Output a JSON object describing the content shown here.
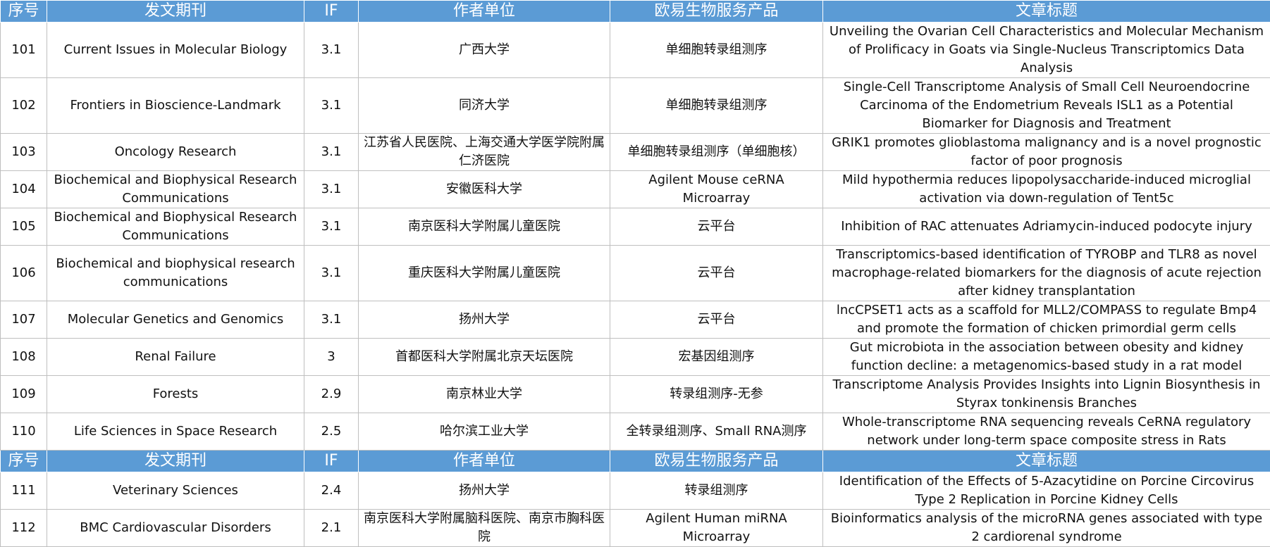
{
  "headers": [
    "序号",
    "发文期刊",
    "IF",
    "作者单位",
    "欧易生物服务产品",
    "文章标题"
  ],
  "rows_a": [
    {
      "no": "101",
      "journal": "Current Issues in Molecular Biology",
      "if": "3.1",
      "unit": "广西大学",
      "service": "单细胞转录组测序",
      "title": "Unveiling the Ovarian Cell Characteristics and Molecular Mechanism of Prolificacy in Goats via Single-Nucleus Transcriptomics Data Analysis"
    },
    {
      "no": "102",
      "journal": "Frontiers in Bioscience-Landmark",
      "if": "3.1",
      "unit": "同济大学",
      "service": "单细胞转录组测序",
      "title": "Single-Cell Transcriptome Analysis of Small Cell Neuroendocrine Carcinoma of the Endometrium Reveals ISL1 as a Potential Biomarker for Diagnosis and Treatment"
    },
    {
      "no": "103",
      "journal": "Oncology Research",
      "if": "3.1",
      "unit": "江苏省人民医院、上海交通大学医学院附属仁济医院",
      "service": "单细胞转录组测序（单细胞核）",
      "title": "GRIK1 promotes glioblastoma malignancy and is a novel prognostic factor of poor prognosis"
    },
    {
      "no": "104",
      "journal": "Biochemical and Biophysical Research Communications",
      "if": "3.1",
      "unit": "安徽医科大学",
      "service": "Agilent Mouse ceRNA Microarray",
      "title": "Mild hypothermia reduces lipopolysaccharide-induced microglial activation via down-regulation of Tent5c"
    },
    {
      "no": "105",
      "journal": "Biochemical and Biophysical Research Communications",
      "if": "3.1",
      "unit": "南京医科大学附属儿童医院",
      "service": "云平台",
      "title": "Inhibition of RAC attenuates Adriamycin-induced podocyte injury"
    },
    {
      "no": "106",
      "journal": "Biochemical and biophysical research communications",
      "if": "3.1",
      "unit": "重庆医科大学附属儿童医院",
      "service": "云平台",
      "title": "Transcriptomics-based identification of TYROBP and TLR8 as novel macrophage-related biomarkers for the diagnosis of acute rejection after kidney transplantation"
    },
    {
      "no": "107",
      "journal": "Molecular Genetics and Genomics",
      "if": "3.1",
      "unit": "扬州大学",
      "service": "云平台",
      "title": "lncCPSET1 acts as a scaffold for MLL2/COMPASS to regulate Bmp4 and promote the formation of chicken primordial germ cells"
    },
    {
      "no": "108",
      "journal": "Renal Failure",
      "if": "3",
      "unit": "首都医科大学附属北京天坛医院",
      "service": "宏基因组测序",
      "title": "Gut microbiota in the association between obesity and kidney function decline: a metagenomics-based study in a rat model"
    },
    {
      "no": "109",
      "journal": "Forests",
      "if": "2.9",
      "unit": "南京林业大学",
      "service": "转录组测序-无参",
      "title": "Transcriptome Analysis Provides Insights into Lignin Biosynthesis in Styrax tonkinensis Branches"
    },
    {
      "no": "110",
      "journal": "Life Sciences in Space Research",
      "if": "2.5",
      "unit": "哈尔滨工业大学",
      "service": "全转录组测序、Small RNA测序",
      "title": "Whole-transcriptome RNA sequencing reveals CeRNA regulatory network under long-term space composite stress in Rats"
    }
  ],
  "rows_b": [
    {
      "no": "111",
      "journal": "Veterinary Sciences",
      "if": "2.4",
      "unit": "扬州大学",
      "service": "转录组测序",
      "title": "Identification of the Effects of 5-Azacytidine on Porcine Circovirus Type 2 Replication in Porcine Kidney Cells"
    },
    {
      "no": "112",
      "journal": "BMC Cardiovascular Disorders",
      "if": "2.1",
      "unit": "南京医科大学附属脑科医院、南京市胸科医院",
      "service": "Agilent Human miRNA Microarray",
      "title": "Bioinformatics analysis of the microRNA genes associated with type 2 cardiorenal syndrome"
    }
  ]
}
